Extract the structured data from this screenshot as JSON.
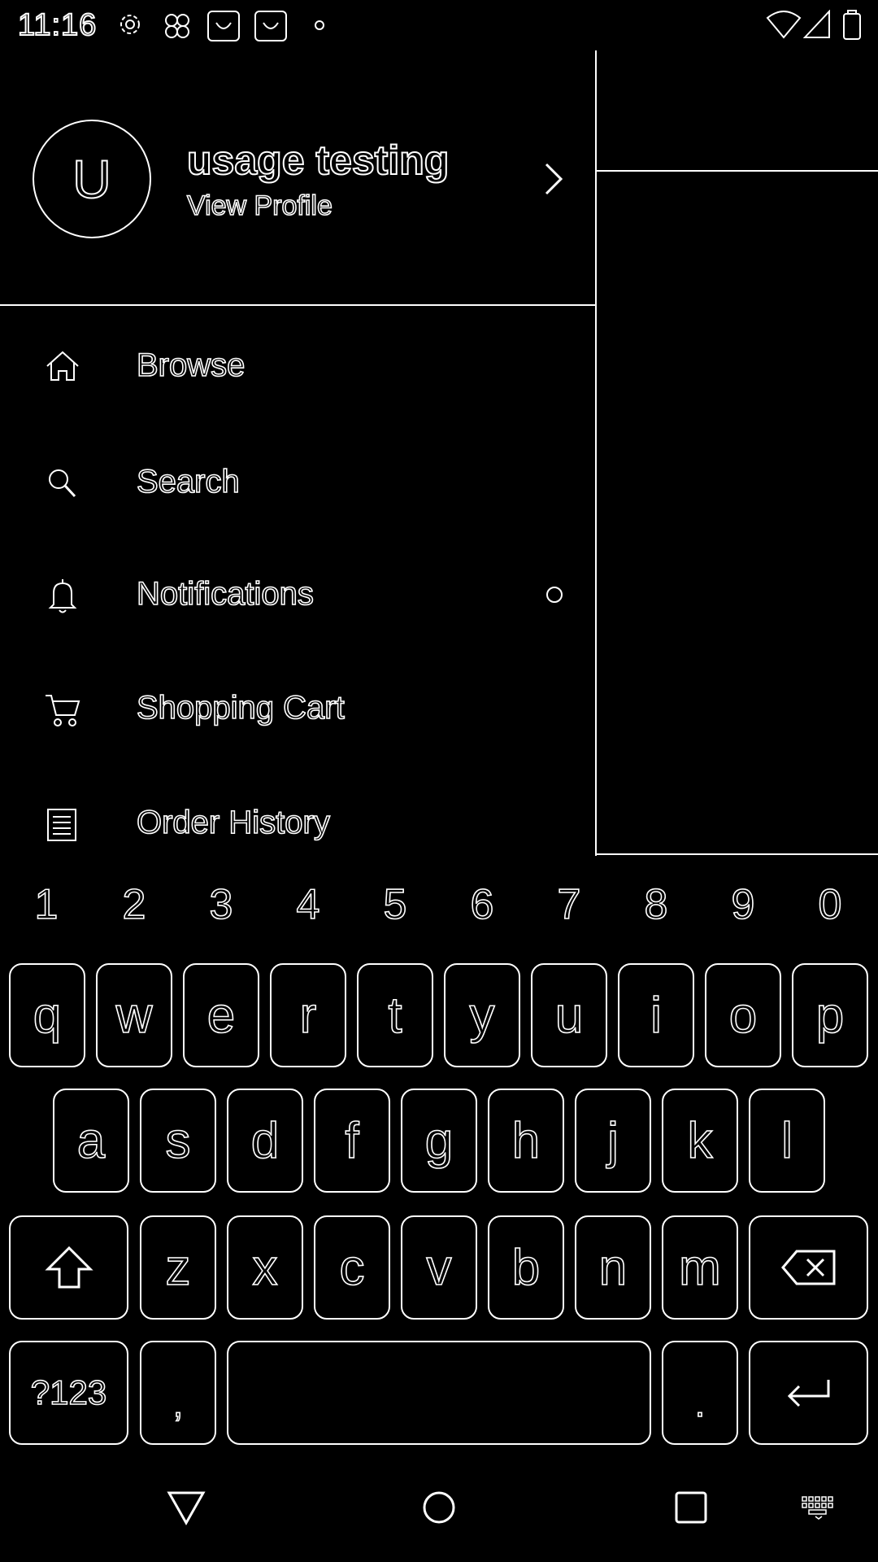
{
  "status_bar": {
    "time": "11:16",
    "icons": [
      "gear-icon",
      "app-grid-icon",
      "app-badge-icon",
      "app-badge-icon",
      "dot-icon",
      "wifi-icon",
      "signal-icon",
      "battery-icon"
    ]
  },
  "drawer": {
    "avatar_letter": "U",
    "user_name": "usage testing",
    "profile_link": "View Profile",
    "items": [
      {
        "label": "Browse",
        "icon": "home-icon"
      },
      {
        "label": "Search",
        "icon": "search-icon"
      },
      {
        "label": "Notifications",
        "icon": "bell-icon",
        "indicator": true
      },
      {
        "label": "Shopping Cart",
        "icon": "cart-icon"
      },
      {
        "label": "Order History",
        "icon": "receipt-icon"
      }
    ]
  },
  "keyboard": {
    "numbers": [
      "1",
      "2",
      "3",
      "4",
      "5",
      "6",
      "7",
      "8",
      "9",
      "0"
    ],
    "row1": [
      "q",
      "w",
      "e",
      "r",
      "t",
      "y",
      "u",
      "i",
      "o",
      "p"
    ],
    "row2": [
      "a",
      "s",
      "d",
      "f",
      "g",
      "h",
      "j",
      "k",
      "l"
    ],
    "row3": [
      "z",
      "x",
      "c",
      "v",
      "b",
      "n",
      "m"
    ],
    "symbols_label": "?123",
    "comma_label": ",",
    "period_label": "."
  },
  "colors": {
    "background": "#000000",
    "outline": "#ffffff"
  }
}
